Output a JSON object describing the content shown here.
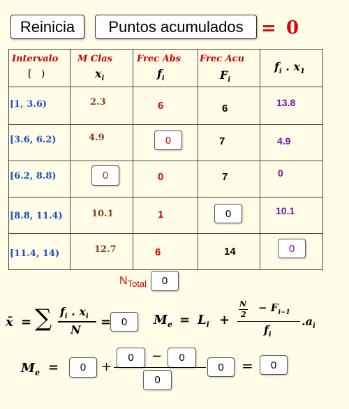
{
  "buttons": {
    "reset": "Reinicia",
    "points": "Puntos acumulados"
  },
  "score": {
    "equals": "=",
    "value": "0"
  },
  "table": {
    "headers": {
      "intervalo": "Intervalo",
      "bracket": "[   )",
      "mclas": "M Clas",
      "mclas_sym": "x",
      "frecabs": "Frec Abs",
      "frecabs_sym": "f",
      "frecacu": "Frec Acu",
      "frecacu_sym": "F",
      "prod_sym": "f . x"
    },
    "rows": [
      {
        "interval": "[1, 3.6)",
        "x": "2.3",
        "f": "6",
        "F": "6",
        "fx": "13.8"
      },
      {
        "interval": "[3.6, 6.2)",
        "x": "4.9",
        "f": "0",
        "F": "7",
        "fx": "4.9"
      },
      {
        "interval": "[6.2, 8.8)",
        "x": "0",
        "f": "0",
        "F": "7",
        "fx": "0"
      },
      {
        "interval": "[8.8, 11.4)",
        "x": "10.1",
        "f": "1",
        "F": "0",
        "fx": "10.1"
      },
      {
        "interval": "[11.4, 14)",
        "x": "12.7",
        "f": "6",
        "F": "14",
        "fx": "0"
      }
    ]
  },
  "ntotal": {
    "label": "N",
    "sub": "Total",
    "value": "0"
  },
  "formula": {
    "mean_sym": "x̄",
    "eq": "=",
    "sigma": "∑",
    "num": "f",
    "den": "N",
    "mean_value": "0",
    "me_sym": "M",
    "me_sub": "e",
    "L": "L",
    "plus": "+",
    "n_over_2": "N",
    "two": "2",
    "minus": "−",
    "F_prev": "F",
    "fi_den": "f",
    "a": ".a"
  },
  "median_calc": {
    "Li_value": "0",
    "n2_value": "0",
    "Fprev_value": "0",
    "fi_value": "0",
    "a_value": "0",
    "result": "0",
    "plus": "+",
    "minus": "−",
    "equals": "="
  }
}
